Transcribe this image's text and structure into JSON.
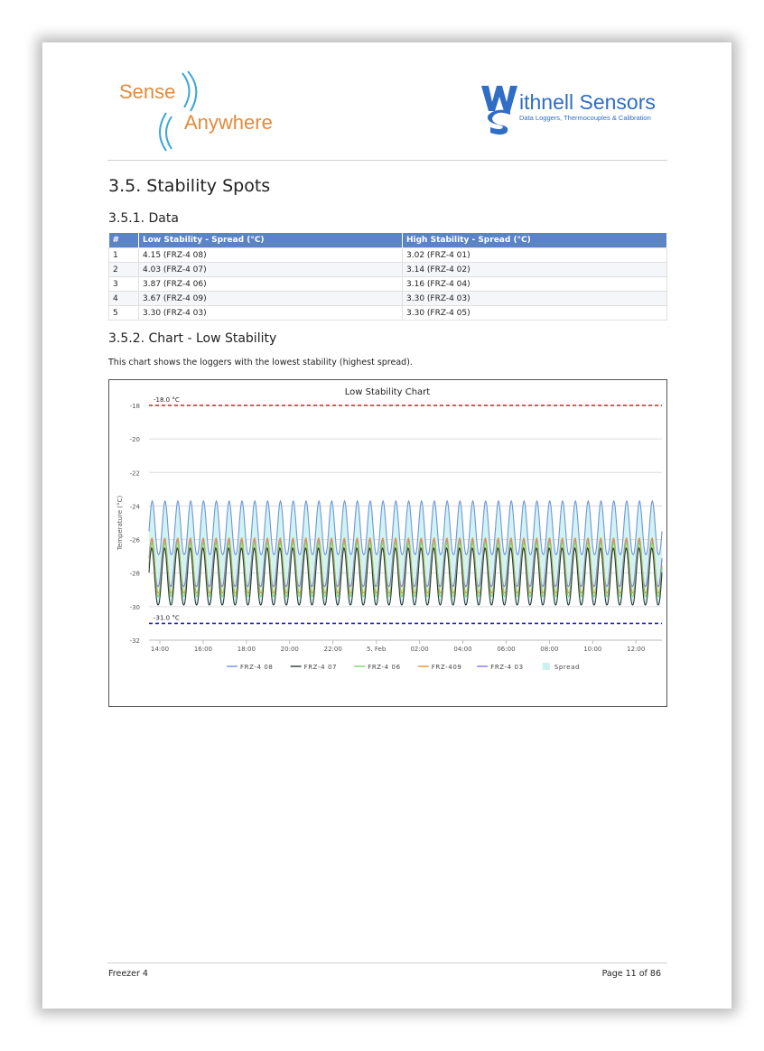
{
  "logos": {
    "left": {
      "line1": "Sense",
      "line2": "Anywhere"
    },
    "right": {
      "name": "ithnell Sensors",
      "tagline": "Data Loggers, Thermocouples & Calibration"
    }
  },
  "section_title": "3.5. Stability Spots",
  "data_title": "3.5.1. Data",
  "table": {
    "headers": [
      "#",
      "Low Stability - Spread (°C)",
      "High Stability - Spread (°C)"
    ],
    "rows": [
      [
        "1",
        "4.15 (FRZ-4 08)",
        "3.02 (FRZ-4 01)"
      ],
      [
        "2",
        "4.03 (FRZ-4 07)",
        "3.14 (FRZ-4 02)"
      ],
      [
        "3",
        "3.87 (FRZ-4 06)",
        "3.16 (FRZ-4 04)"
      ],
      [
        "4",
        "3.67 (FRZ-4 09)",
        "3.30 (FRZ-4 03)"
      ],
      [
        "5",
        "3.30 (FRZ-4 03)",
        "3.30 (FRZ-4 05)"
      ]
    ]
  },
  "chart_title_heading": "3.5.2. Chart - Low Stability",
  "chart_description": "This chart shows the loggers with the lowest stability (highest spread).",
  "chart_data": {
    "type": "line",
    "title": "Low Stability Chart",
    "ylabel": "Temperature (°C)",
    "ylim": [
      -32,
      -18
    ],
    "yticks": [
      -18,
      -20,
      -22,
      -24,
      -26,
      -28,
      -30,
      -32
    ],
    "xticks": [
      "14:00",
      "16:00",
      "18:00",
      "20:00",
      "22:00",
      "5. Feb",
      "02:00",
      "04:00",
      "06:00",
      "08:00",
      "10:00",
      "12:00"
    ],
    "x_hours": [
      13.5,
      37.2
    ],
    "cycle_count": 40,
    "limits": [
      {
        "label": "-18.0 °C",
        "value": -18.0,
        "color": "#d42020"
      },
      {
        "label": "-31.0 °C",
        "value": -31.0,
        "color": "#2323c8"
      }
    ],
    "series": [
      {
        "name": "FRZ-4 08",
        "color": "#6f95dd",
        "min": -26.9,
        "max": -23.7
      },
      {
        "name": "FRZ-4 07",
        "color": "#2a3b3a",
        "min": -29.9,
        "max": -26.5
      },
      {
        "name": "FRZ-4 06",
        "color": "#7ed36a",
        "min": -29.4,
        "max": -26.2
      },
      {
        "name": "FRZ-409",
        "color": "#e8953c",
        "min": -29.2,
        "max": -25.9
      },
      {
        "name": "FRZ-4 03",
        "color": "#7c7ce8",
        "min": -28.8,
        "max": -26.0
      }
    ],
    "spread": {
      "name": "Spread",
      "color": "#c9f1ee"
    },
    "grid": true,
    "legend": "bottom"
  },
  "footer": {
    "left": "Freezer 4",
    "right": "Page 11 of 86"
  }
}
